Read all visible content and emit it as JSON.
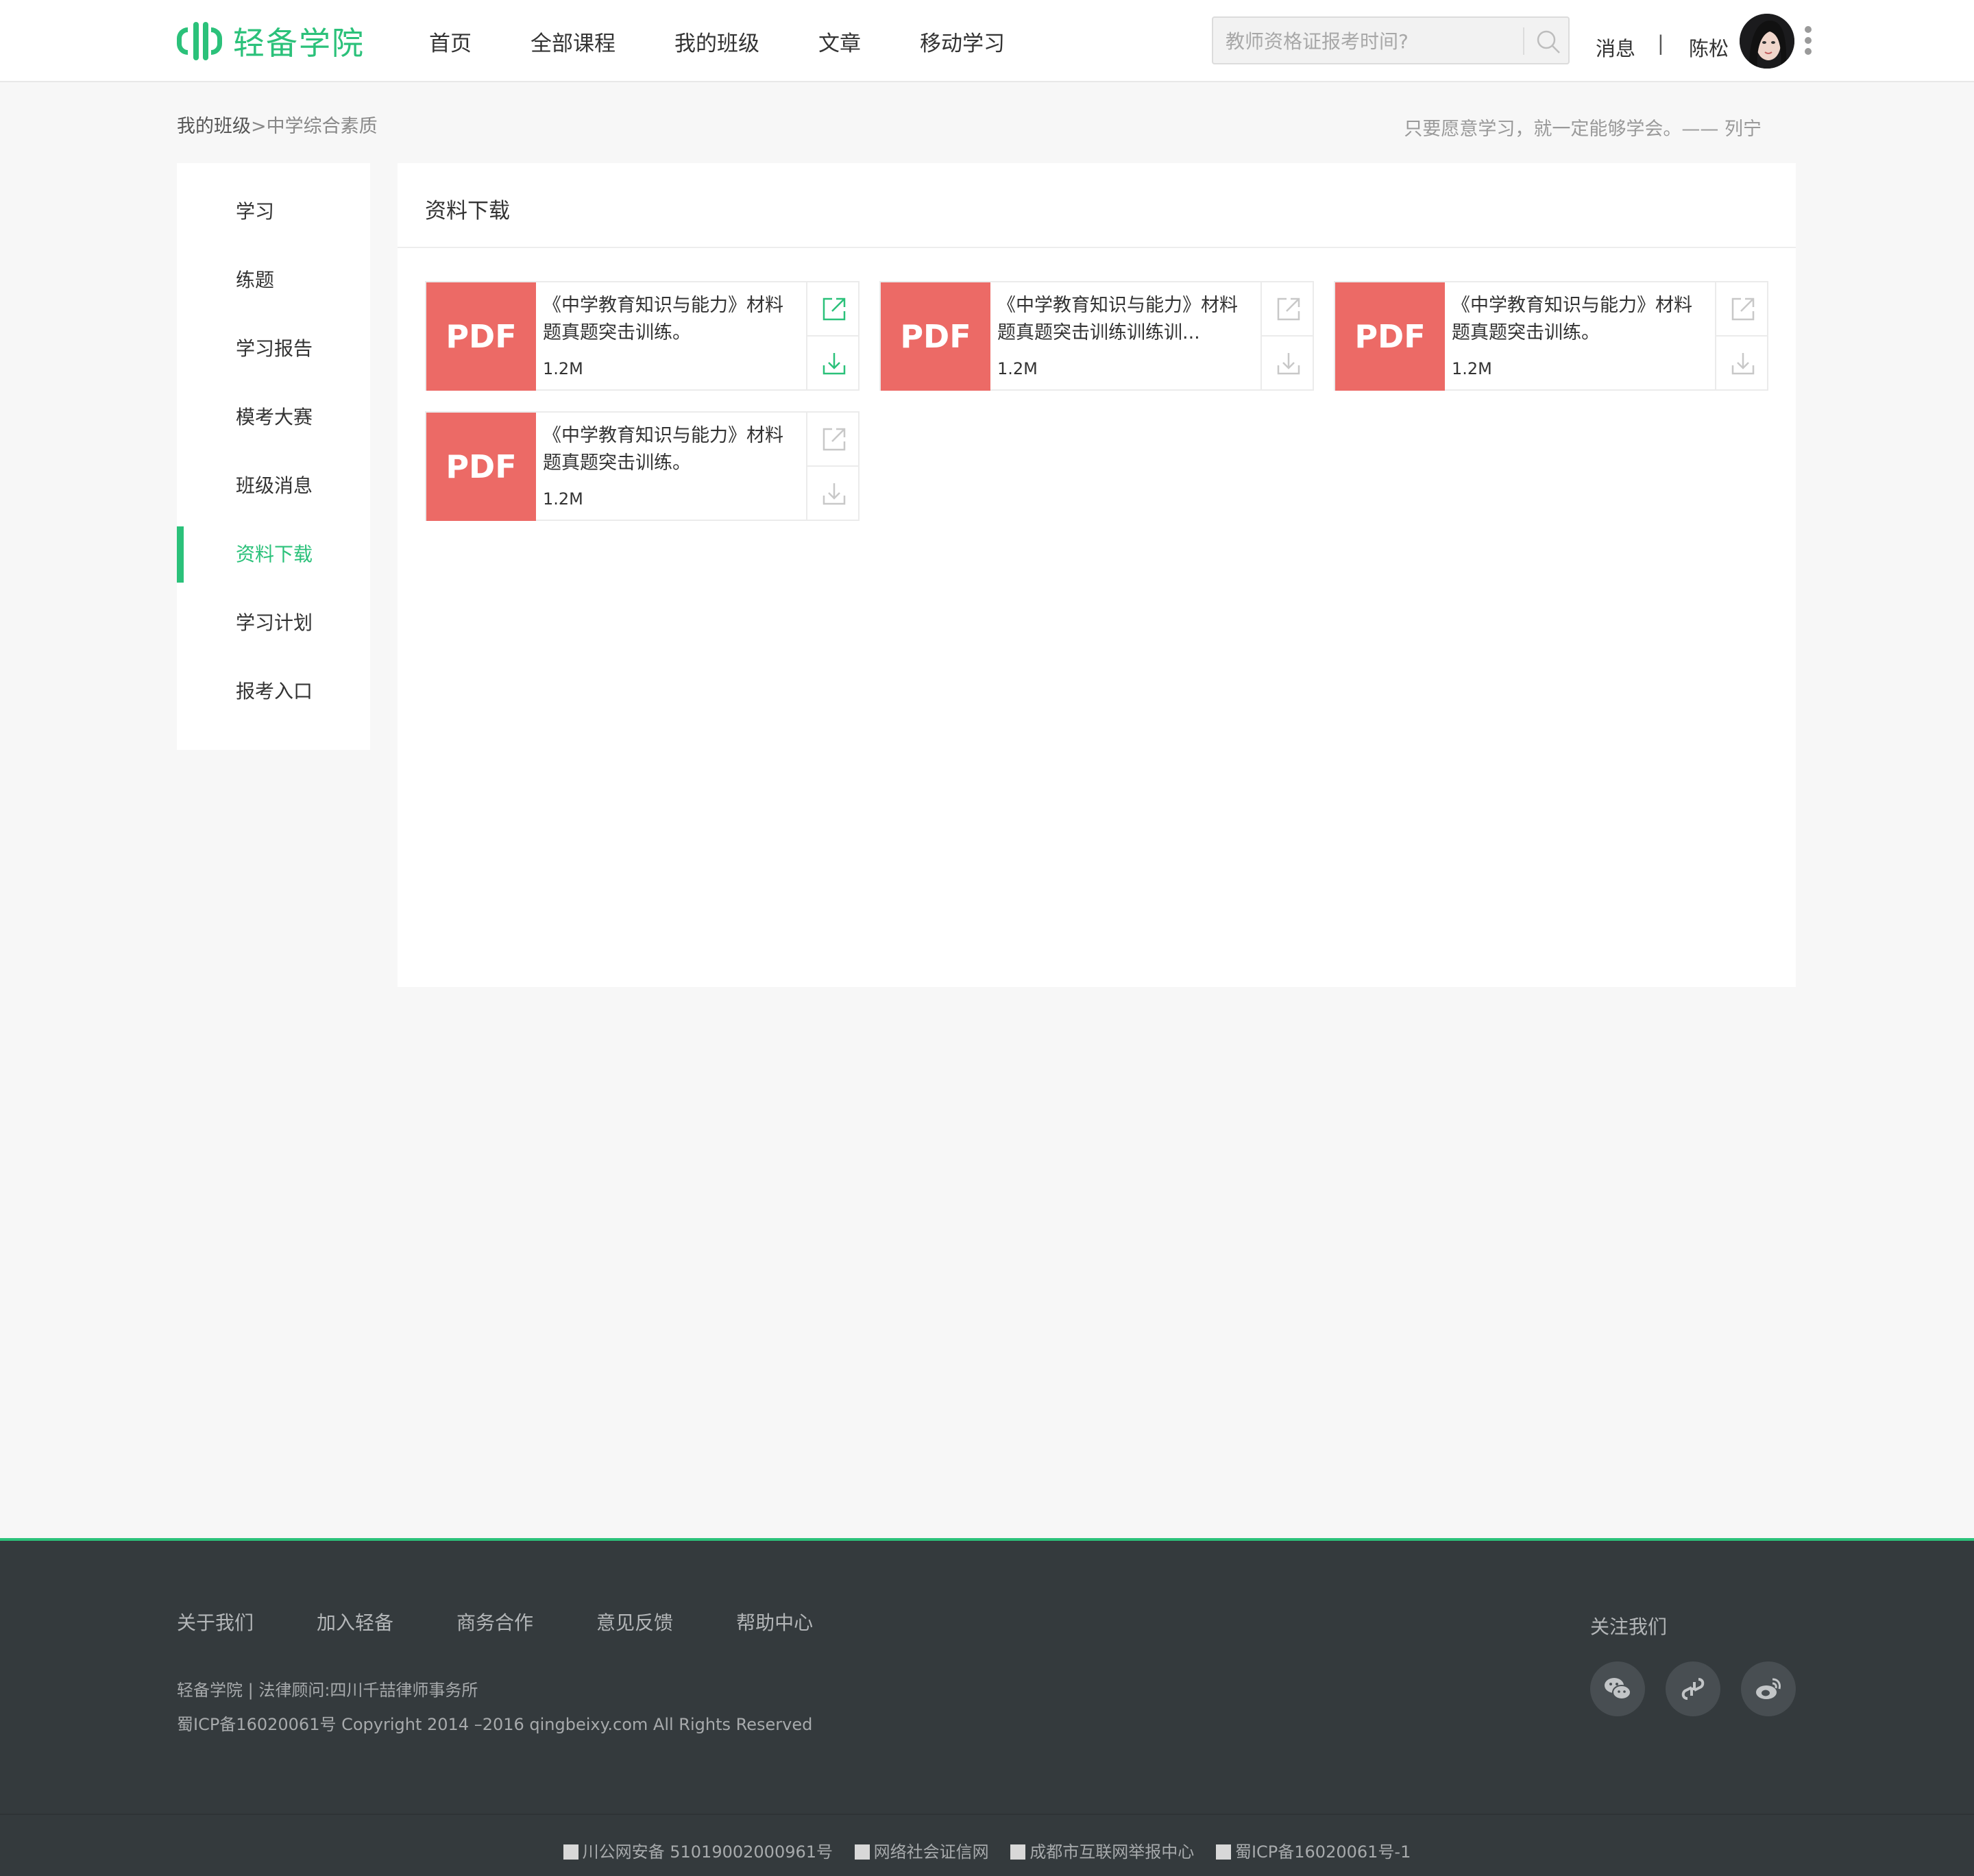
{
  "brand": {
    "name": "轻备学院",
    "accent": "#2bc17a"
  },
  "nav": [
    "首页",
    "全部课程",
    "我的班级",
    "文章",
    "移动学习"
  ],
  "search": {
    "placeholder": "教师资格证报考时间?"
  },
  "user": {
    "messages": "消息",
    "separator": "|",
    "name": "陈松"
  },
  "breadcrumb": {
    "parent": "我的班级",
    "sep": ">",
    "current": "中学综合素质"
  },
  "quote": "只要愿意学习，就一定能够学会。—— 列宁",
  "sidebar": {
    "items": [
      "学习",
      "练题",
      "学习报告",
      "模考大赛",
      "班级消息",
      "资料下载",
      "学习计划",
      "报考入口"
    ],
    "active": "资料下载"
  },
  "main": {
    "title": "资料下载",
    "files": [
      {
        "badge": "PDF",
        "name": "《中学教育知识与能力》材料题真题突击训练。",
        "size": "1.2M",
        "highlighted": true
      },
      {
        "badge": "PDF",
        "name": "《中学教育知识与能力》材料题真题突击训练训练训...",
        "size": "1.2M",
        "highlighted": false
      },
      {
        "badge": "PDF",
        "name": "《中学教育知识与能力》材料题真题突击训练。",
        "size": "1.2M",
        "highlighted": false
      },
      {
        "badge": "PDF",
        "name": "《中学教育知识与能力》材料题真题突击训练。",
        "size": "1.2M",
        "highlighted": false
      }
    ]
  },
  "footer": {
    "links": [
      "关于我们",
      "加入轻备",
      "商务合作",
      "意见反馈",
      "帮助中心"
    ],
    "line1": "轻备学院 | 法律顾问:四川千喆律师事务所",
    "line2": "蜀ICP备16020061号 Copyright 2014 –2016 qingbeixy.com All Rights Reserved",
    "follow": "关注我们",
    "social_icons": [
      "wechat-icon",
      "link-icon",
      "weibo-icon"
    ],
    "bottom": [
      "川公网安备 51019002000961号",
      "网络社会证信网",
      "成都市互联网举报中心",
      "蜀ICP备16020061号-1"
    ]
  },
  "colors": {
    "pdf_badge": "#ec6a66",
    "footer_bg": "#343a3d",
    "page_bg": "#f7f7f7"
  }
}
